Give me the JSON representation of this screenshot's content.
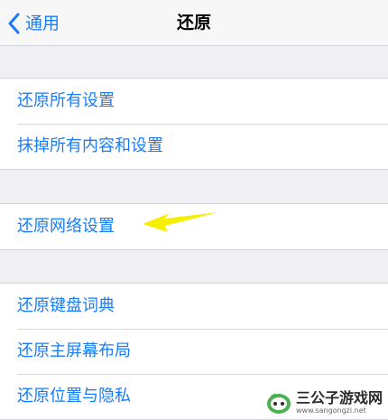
{
  "navbar": {
    "back_label": "通用",
    "title": "还原"
  },
  "groups": [
    {
      "items": [
        "还原所有设置",
        "抹掉所有内容和设置"
      ]
    },
    {
      "items": [
        "还原网络设置"
      ]
    },
    {
      "items": [
        "还原键盘词典",
        "还原主屏幕布局",
        "还原位置与隐私"
      ]
    }
  ],
  "annotation": {
    "arrow_color": "#f5f000"
  },
  "watermark": {
    "title": "三公子游戏网",
    "url": "www.sangongzi.net"
  },
  "colors": {
    "accent": "#1a7cf5",
    "background": "#efeff4"
  }
}
